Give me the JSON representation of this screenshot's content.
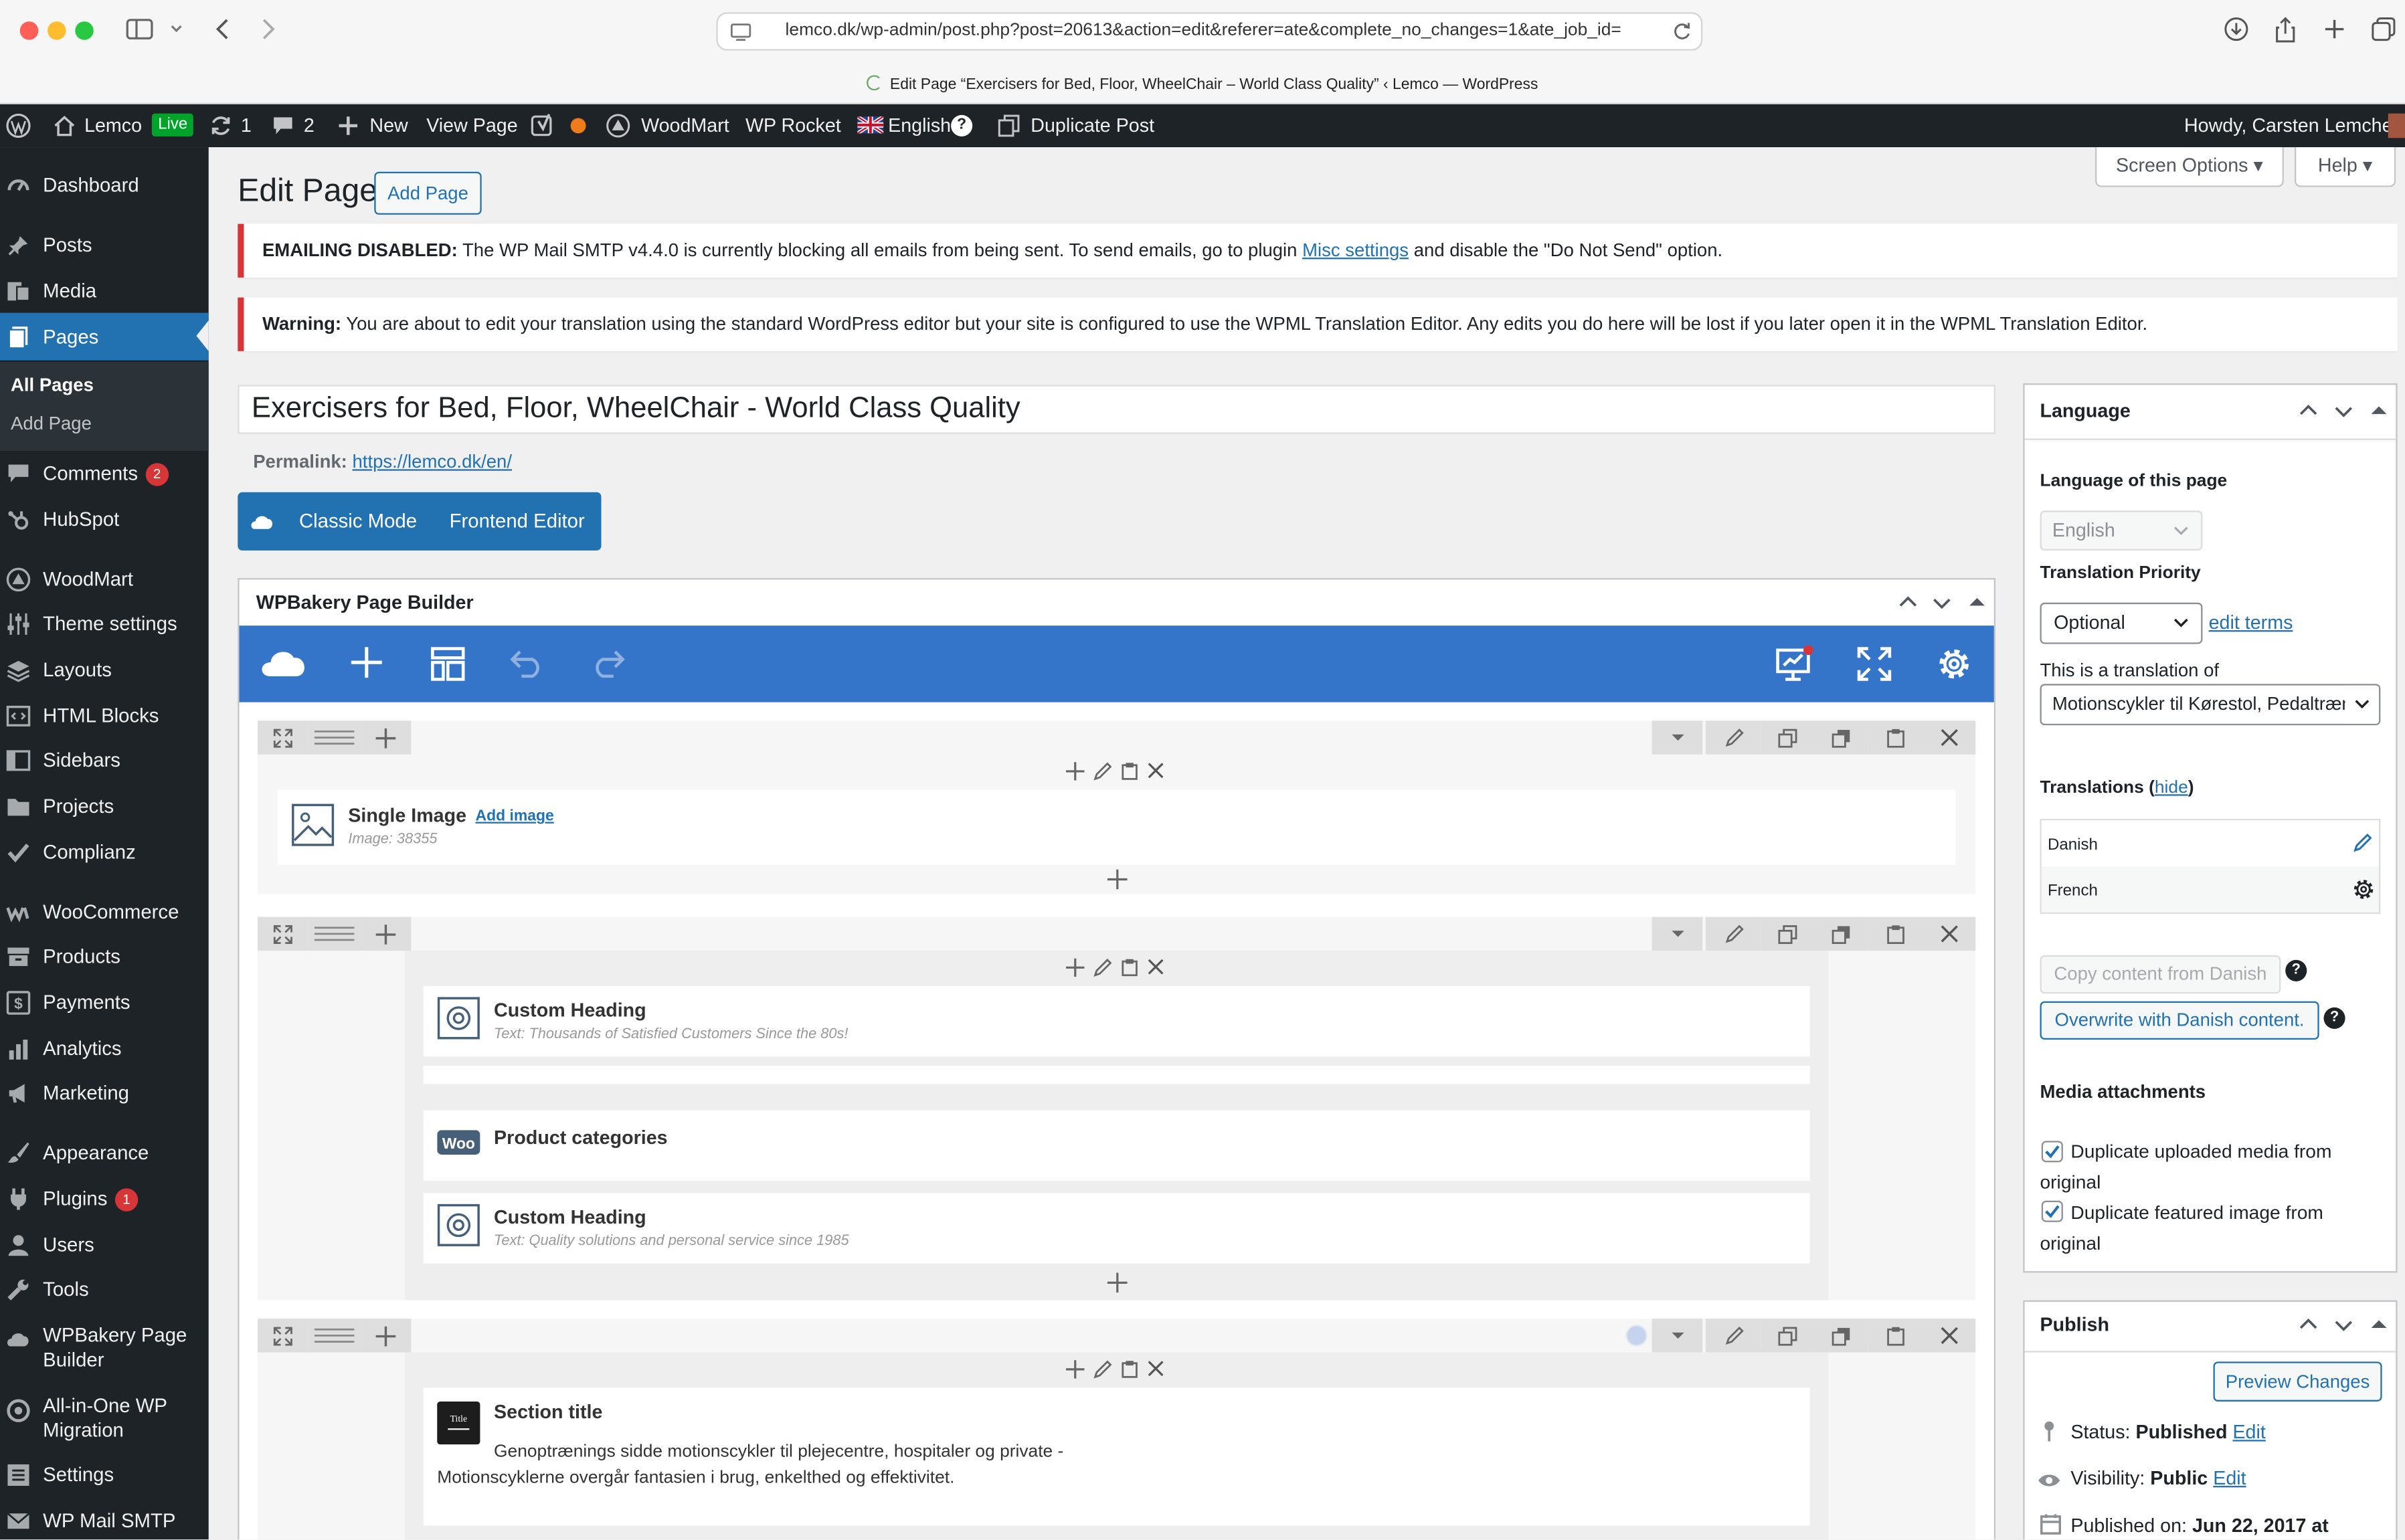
{
  "browser": {
    "url": "lemco.dk/wp-admin/post.php?post=20613&action=edit&referer=ate&complete_no_changes=1&ate_job_id=",
    "tab_title": "Edit Page “Exercisers for Bed, Floor, WheelChair – World Class Quality” ‹ Lemco — WordPress"
  },
  "admin_bar": {
    "site": "Lemco",
    "live": "Live",
    "updates": "1",
    "comments": "2",
    "new": "New",
    "view_page": "View Page",
    "woodmart": "WoodMart",
    "wp_rocket": "WP Rocket",
    "language": "English",
    "duplicate_post": "Duplicate Post",
    "howdy": "Howdy, Carsten Lemche"
  },
  "sidebar": {
    "items": [
      {
        "label": "Dashboard",
        "icon": "dashboard-icon"
      },
      {
        "label": "Posts",
        "icon": "pin-icon"
      },
      {
        "label": "Media",
        "icon": "media-icon"
      },
      {
        "label": "Pages",
        "icon": "pages-icon"
      },
      {
        "label": "Comments",
        "icon": "comment-icon",
        "badge": "2"
      },
      {
        "label": "HubSpot",
        "icon": "hubspot-icon"
      },
      {
        "label": "WoodMart",
        "icon": "woodmart-icon"
      },
      {
        "label": "Theme settings",
        "icon": "sliders-icon"
      },
      {
        "label": "Layouts",
        "icon": "layers-icon"
      },
      {
        "label": "HTML Blocks",
        "icon": "html-icon"
      },
      {
        "label": "Sidebars",
        "icon": "sidebar-icon"
      },
      {
        "label": "Projects",
        "icon": "folder-icon"
      },
      {
        "label": "Complianz",
        "icon": "check-icon"
      },
      {
        "label": "WooCommerce",
        "icon": "woo-icon"
      },
      {
        "label": "Products",
        "icon": "archive-icon"
      },
      {
        "label": "Payments",
        "icon": "dollar-icon"
      },
      {
        "label": "Analytics",
        "icon": "bar-chart-icon"
      },
      {
        "label": "Marketing",
        "icon": "megaphone-icon"
      },
      {
        "label": "Appearance",
        "icon": "brush-icon"
      },
      {
        "label": "Plugins",
        "icon": "plug-icon",
        "badge": "1"
      },
      {
        "label": "Users",
        "icon": "user-icon"
      },
      {
        "label": "Tools",
        "icon": "wrench-icon"
      },
      {
        "label": "WPBakery Page Builder",
        "icon": "wpbakery-icon"
      },
      {
        "label": "All-in-One WP Migration",
        "icon": "migration-icon"
      },
      {
        "label": "Settings",
        "icon": "settings-icon"
      },
      {
        "label": "WP Mail SMTP",
        "icon": "mail-icon"
      }
    ],
    "submenu": [
      "All Pages",
      "Add Page"
    ]
  },
  "header": {
    "title": "Edit Page",
    "add_page": "Add Page",
    "screen_options": "Screen Options",
    "help": "Help"
  },
  "notices": {
    "email_strong": "EMAILING DISABLED:",
    "email_text": " The WP Mail SMTP v4.4.0 is currently blocking all emails from being sent. To send emails, go to plugin ",
    "email_link": "Misc settings",
    "email_tail": " and disable the \"Do Not Send\" option.",
    "warn_strong": "Warning:",
    "warn_text": " You are about to edit your translation using the standard WordPress editor but your site is configured to use the WPML Translation Editor. Any edits you do here will be lost if you later open it in the WPML Translation Editor."
  },
  "editor": {
    "post_title": "Exercisers for Bed, Floor, WheelChair - World Class Quality",
    "permalink_label": "Permalink:",
    "permalink_url": "https://lemco.dk/en/",
    "classic_mode": "Classic Mode",
    "frontend_editor": "Frontend Editor",
    "builder_title": "WPBakery Page Builder",
    "elements": {
      "single_image_title": "Single Image",
      "single_image_add": "Add image",
      "single_image_sub": "Image: 38355",
      "heading1_title": "Custom Heading",
      "heading1_sub": "Text: Thousands of Satisfied Customers Since the 80s!",
      "product_categories": "Product categories",
      "heading2_title": "Custom Heading",
      "heading2_sub": "Text: Quality solutions and personal service since 1985",
      "section_title": "Section title",
      "section_text1": "Genoptrænings sidde motionscykler til plejecentre, hospitaler og private -",
      "section_text2": "Motionscyklerne overgår fantasien i brug, enkelthed og effektivitet."
    }
  },
  "language_box": {
    "title": "Language",
    "language_label": "Language of this page",
    "language_value": "English",
    "priority_label": "Translation Priority",
    "priority_value": "Optional",
    "edit_terms": "edit terms",
    "translation_of_label": "This is a translation of",
    "translation_of_value": "Motionscykler til Kørestol, Pedaltræner",
    "translations_label": "Translations (",
    "hide": "hide",
    "close_paren": ")",
    "translations": [
      "Danish",
      "French"
    ],
    "copy_content": "Copy content from Danish",
    "overwrite": "Overwrite with Danish content.",
    "media_title": "Media attachments",
    "dup_media": "Duplicate uploaded media from original",
    "dup_featured": "Duplicate featured image from original"
  },
  "publish_box": {
    "title": "Publish",
    "preview": "Preview Changes",
    "status_label": "Status:",
    "status_value": "Published",
    "visibility_label": "Visibility:",
    "visibility_value": "Public",
    "published_label": "Published on:",
    "published_value": "Jun 22, 2017 at",
    "edit": "Edit"
  },
  "colors": {
    "accent": "#2271b1",
    "builder_blue": "#3575c9",
    "admin_dark": "#1d2327",
    "error_red": "#d63638"
  }
}
